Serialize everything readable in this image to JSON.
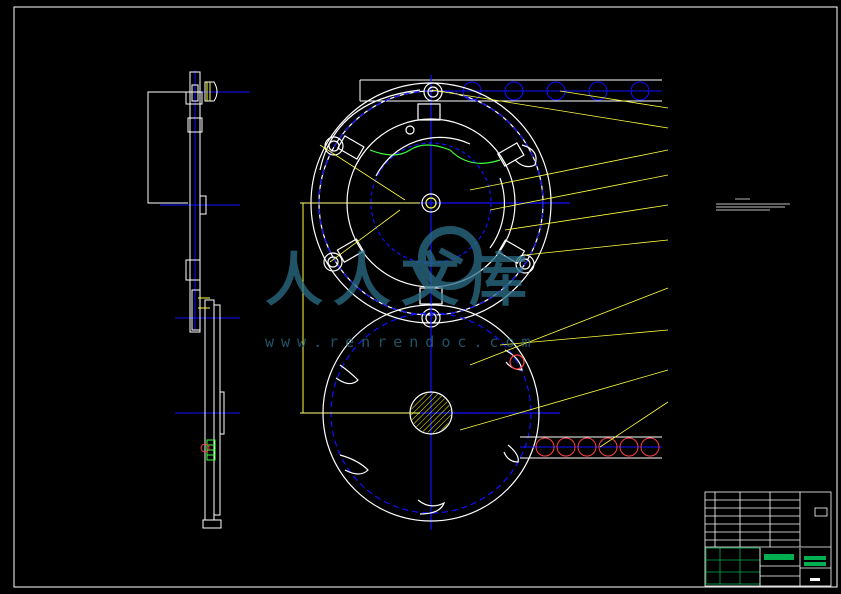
{
  "watermark": {
    "brand": "人人文库",
    "url": "www.renrendoc.com"
  },
  "colors": {
    "background": "#000000",
    "outline": "#ffffff",
    "centerline": "#1010ff",
    "leader": "#ffff40",
    "hatch": "#ffff00",
    "section": "#40ff40",
    "watermark": "#2c6f8a",
    "titleblock_green": "#00b050"
  },
  "note_block": {
    "icon": "text-note-icon"
  }
}
